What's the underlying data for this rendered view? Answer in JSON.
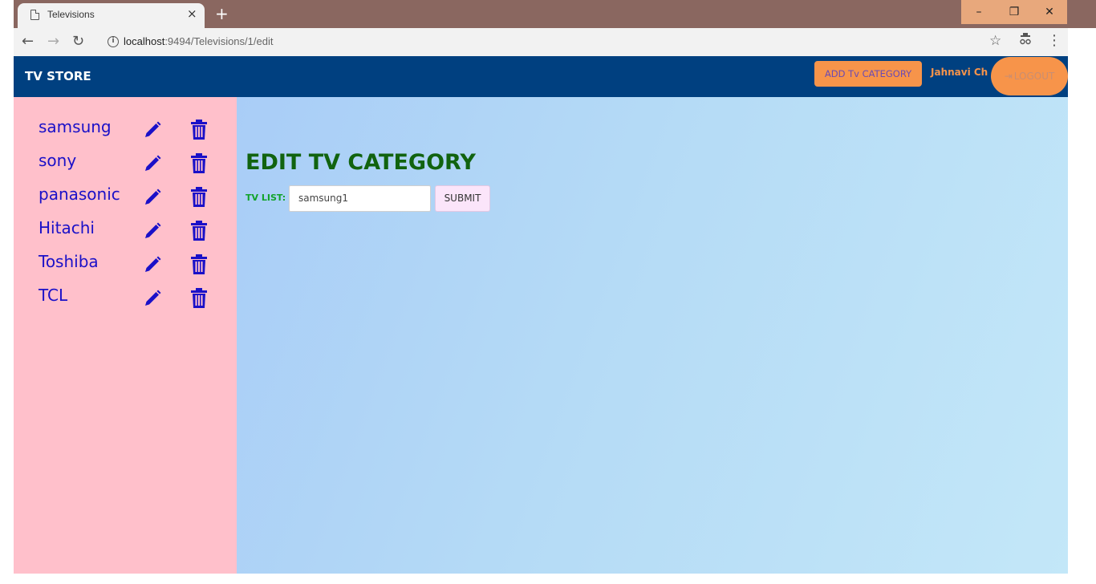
{
  "browser": {
    "tab_title": "Televisions",
    "tab_close": "×",
    "new_tab": "+",
    "url_host": "localhost",
    "url_rest": ":9494/Televisions/1/edit",
    "win_minimize": "–",
    "win_maximize": "❐",
    "win_close": "✕"
  },
  "header": {
    "brand": "TV STORE",
    "add_category_label": "ADD Tv CATEGORY",
    "user_name": "Jahnavi Ch",
    "logout_label": "LOGOUT"
  },
  "sidebar": {
    "items": [
      {
        "label": "samsung"
      },
      {
        "label": "sony"
      },
      {
        "label": "panasonic"
      },
      {
        "label": "Hitachi"
      },
      {
        "label": "Toshiba"
      },
      {
        "label": "TCL"
      }
    ],
    "icon_color": "#1a10c8"
  },
  "main": {
    "title": "EDIT TV CATEGORY",
    "field_label": "TV LIST:",
    "field_value": "samsung1",
    "submit_label": "SUBMIT"
  },
  "colors": {
    "header_bg": "#004080",
    "accent_orange": "#f7944a",
    "sidebar_bg": "#ffc0cb",
    "title_green": "#11630f"
  }
}
